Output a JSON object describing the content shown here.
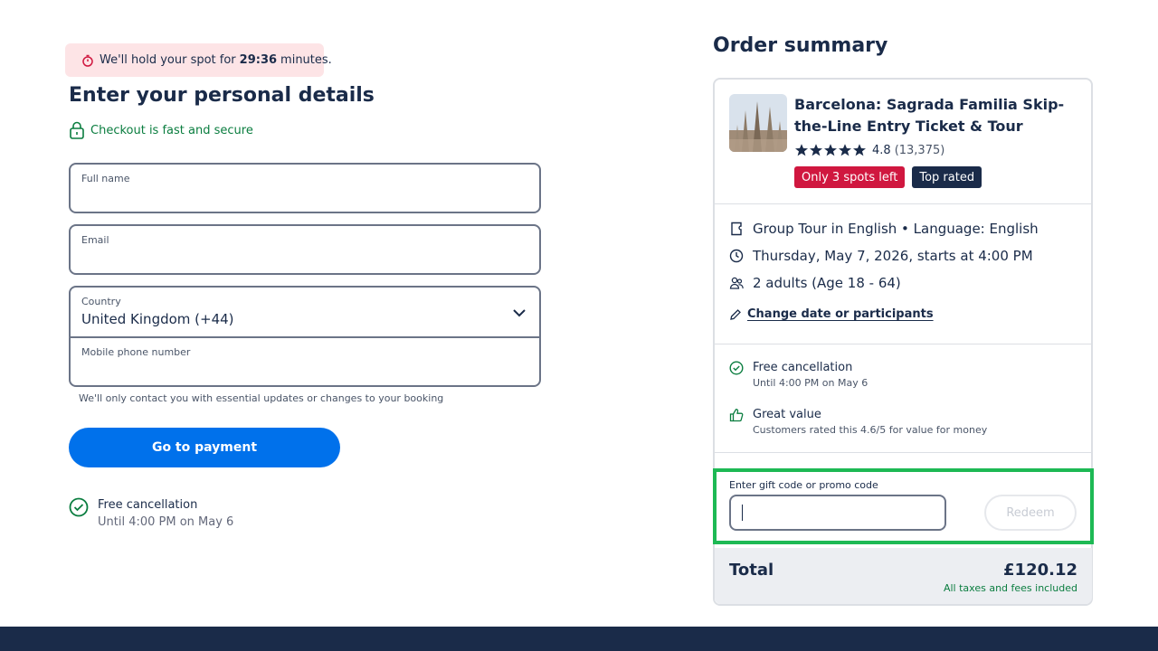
{
  "timer": {
    "prefix": "We'll hold your spot for",
    "time": "29:36",
    "suffix": "minutes."
  },
  "form": {
    "title": "Enter your personal details",
    "secure_text": "Checkout is fast and secure",
    "full_name": {
      "label": "Full name",
      "value": ""
    },
    "email": {
      "label": "Email",
      "value": ""
    },
    "country": {
      "label": "Country",
      "value": "United Kingdom (+44)"
    },
    "phone": {
      "label": "Mobile phone number",
      "value": ""
    },
    "helper": "We'll only contact you with essential updates or changes to your booking",
    "submit_label": "Go to payment",
    "cancellation": {
      "title": "Free cancellation",
      "detail": "Until 4:00 PM on May 6"
    }
  },
  "summary": {
    "title": "Order summary",
    "product": {
      "title": "Barcelona: Sagrada Familia Skip-the-Line Entry Ticket & Tour",
      "rating": "4.8",
      "review_count": "(13,375)",
      "stars": 5,
      "badges": [
        "Only 3 spots left",
        "Top rated"
      ]
    },
    "details": {
      "option": "Group Tour in English • Language: English",
      "date": "Thursday, May 7, 2026, starts at 4:00 PM",
      "participants": "2 adults (Age 18 - 64)",
      "change_link": "Change date or participants"
    },
    "perks": [
      {
        "title": "Free cancellation",
        "detail": "Until 4:00 PM on May 6"
      },
      {
        "title": "Great value",
        "detail": "Customers rated this 4.6/5 for value for money"
      }
    ],
    "promo": {
      "label": "Enter gift code or promo code",
      "value": "",
      "button": "Redeem"
    },
    "total": {
      "label": "Total",
      "amount": "£120.12",
      "note": "All taxes and fees included"
    }
  },
  "colors": {
    "primary": "#0071eb",
    "navy": "#1a2b49",
    "success": "#0a7d3f",
    "danger": "#d0173f",
    "highlight": "#1db954",
    "timer_bg": "#fde4e6"
  }
}
